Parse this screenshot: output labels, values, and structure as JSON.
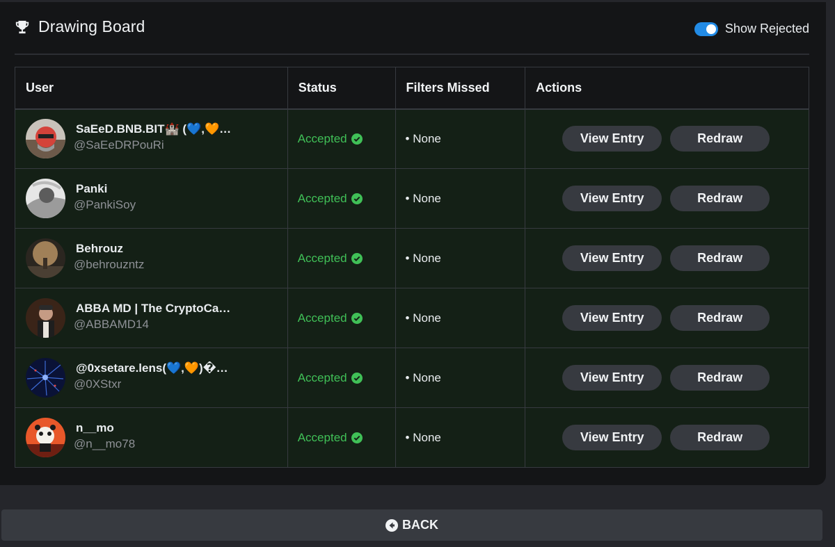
{
  "header": {
    "title": "Drawing Board",
    "title_icon": "trophy-icon",
    "toggle_label": "Show Rejected",
    "toggle_on": true
  },
  "table": {
    "columns": [
      "User",
      "Status",
      "Filters Missed",
      "Actions"
    ],
    "rows": [
      {
        "name": "SaEeD.BNB.BIT🏰 (💙,🧡…",
        "handle": "@SaEeDRPouRi",
        "status": "Accepted",
        "filters": "• None",
        "view_label": "View Entry",
        "redraw_label": "Redraw"
      },
      {
        "name": "Panki",
        "handle": "@PankiSoy",
        "status": "Accepted",
        "filters": "• None",
        "view_label": "View Entry",
        "redraw_label": "Redraw"
      },
      {
        "name": "Behrouz",
        "handle": "@behrouzntz",
        "status": "Accepted",
        "filters": "• None",
        "view_label": "View Entry",
        "redraw_label": "Redraw"
      },
      {
        "name": "ABBA MD | The CryptoCa…",
        "handle": "@ABBAMD14",
        "status": "Accepted",
        "filters": "• None",
        "view_label": "View Entry",
        "redraw_label": "Redraw"
      },
      {
        "name": "@0xsetare.lens(💙,🧡)�…",
        "handle": "@0XStxr",
        "status": "Accepted",
        "filters": "• None",
        "view_label": "View Entry",
        "redraw_label": "Redraw"
      },
      {
        "name": "n__mo",
        "handle": "@n__mo78",
        "status": "Accepted",
        "filters": "• None",
        "view_label": "View Entry",
        "redraw_label": "Redraw"
      }
    ]
  },
  "footer": {
    "back_label": "BACK"
  },
  "colors": {
    "accent": "#228be6",
    "accepted": "#40c057",
    "row_bg": "#142016",
    "panel_bg": "#141517",
    "button_bg": "#373a40"
  }
}
